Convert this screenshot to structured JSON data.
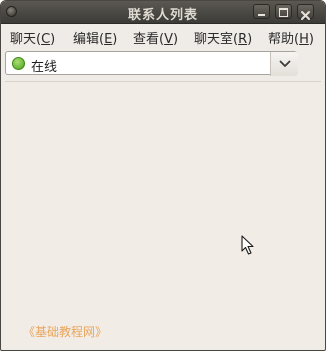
{
  "window": {
    "title": "联系人列表",
    "controls": {
      "minimize": "minimize-icon",
      "maximize": "maximize-icon",
      "close": "close-icon"
    }
  },
  "menubar": {
    "items": [
      {
        "label": "聊天(",
        "mnemonic": "C",
        "suffix": ")"
      },
      {
        "label": "编辑(",
        "mnemonic": "E",
        "suffix": ")"
      },
      {
        "label": "查看(",
        "mnemonic": "V",
        "suffix": ")"
      },
      {
        "label": "聊天室(",
        "mnemonic": "R",
        "suffix": ")"
      },
      {
        "label": "帮助(",
        "mnemonic": "H",
        "suffix": ")"
      }
    ]
  },
  "status": {
    "selected": "在线",
    "indicator_color": "#5cb82b",
    "dropdown_icon": "chevron-down-icon"
  },
  "contacts": {
    "watermark": "《基础教程网》"
  },
  "colors": {
    "titlebar": "#3c3b37",
    "window_bg": "#efebe7",
    "watermark": "#e8a55a"
  }
}
